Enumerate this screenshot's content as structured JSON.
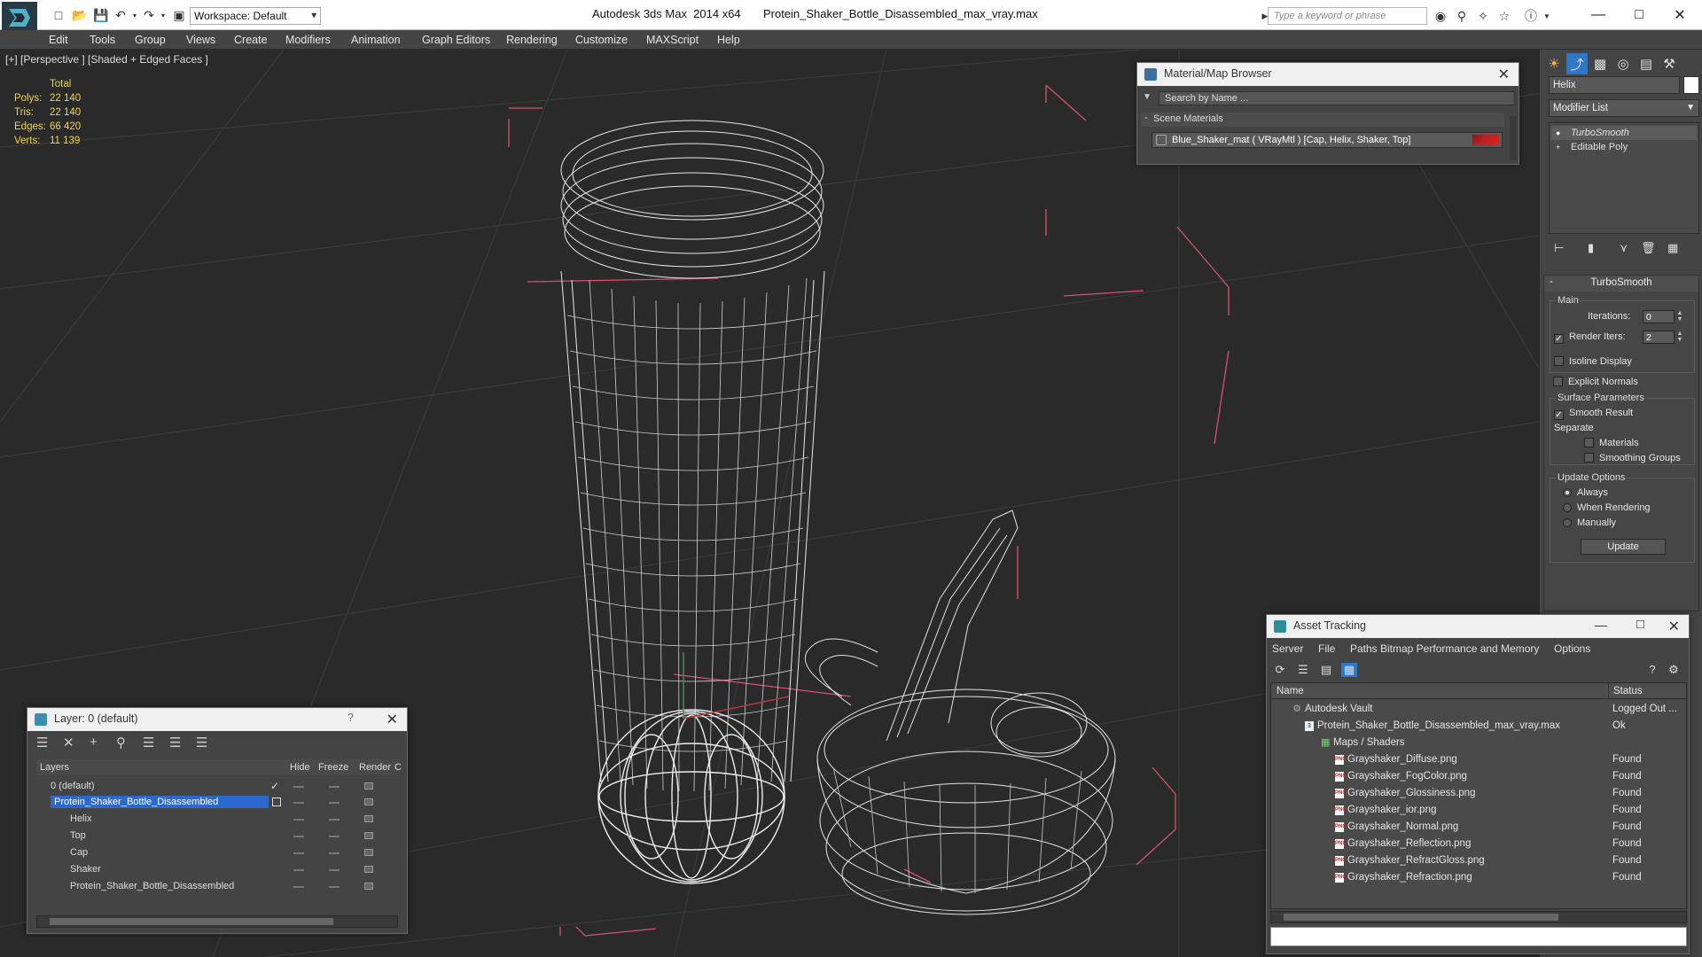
{
  "titlebar": {
    "workspace_label": "Workspace: Default",
    "app_title": "Autodesk 3ds Max  2014 x64",
    "file_title": "Protein_Shaker_Bottle_Disassembled_max_vray.max",
    "search_placeholder": "Type a keyword or phrase"
  },
  "menu": [
    "Edit",
    "Tools",
    "Group",
    "Views",
    "Create",
    "Modifiers",
    "Animation",
    "Graph Editors",
    "Rendering",
    "Customize",
    "MAXScript",
    "Help"
  ],
  "viewport": {
    "label": "[+] [Perspective ] [Shaded + Edged Faces ]",
    "stats": {
      "header": "Total",
      "rows": [
        {
          "key": "Polys:",
          "value": "22 140"
        },
        {
          "key": "Tris:",
          "value": "22 140"
        },
        {
          "key": "Edges:",
          "value": "66 420"
        },
        {
          "key": "Verts:",
          "value": "11 139"
        }
      ]
    }
  },
  "command_panel": {
    "object_name": "Helix",
    "modifier_list": "Modifier List",
    "stack": [
      "TurboSmooth",
      "Editable Poly"
    ],
    "rollout_title": "TurboSmooth",
    "main_group": "Main",
    "iterations_label": "Iterations:",
    "iterations_value": "0",
    "render_iters_label": "Render Iters:",
    "render_iters_value": "2",
    "isoline_label": "Isoline Display",
    "explicit_normals_label": "Explicit Normals",
    "surface_group": "Surface Parameters",
    "smooth_result_label": "Smooth Result",
    "separate_label": "Separate",
    "materials_label": "Materials",
    "smoothing_groups_label": "Smoothing Groups",
    "update_group": "Update Options",
    "always_label": "Always",
    "when_rendering_label": "When Rendering",
    "manually_label": "Manually",
    "update_button": "Update"
  },
  "material_browser": {
    "title": "Material/Map Browser",
    "search_placeholder": "Search by Name ...",
    "section": "Scene Materials",
    "material": "Blue_Shaker_mat  ( VRayMtl ) [Cap, Helix, Shaker, Top]"
  },
  "layer_window": {
    "title": "Layer: 0 (default)",
    "help": "?",
    "columns": {
      "layers": "Layers",
      "hide": "Hide",
      "freeze": "Freeze",
      "render": "Render",
      "c": "C"
    },
    "rows": [
      {
        "name": "0 (default)"
      },
      {
        "name": "Protein_Shaker_Bottle_Disassembled"
      },
      {
        "name": "Helix"
      },
      {
        "name": "Top"
      },
      {
        "name": "Cap"
      },
      {
        "name": "Shaker"
      },
      {
        "name": "Protein_Shaker_Bottle_Disassembled"
      }
    ]
  },
  "asset_tracking": {
    "title": "Asset Tracking",
    "menu": [
      "Server",
      "File",
      "Paths",
      "Bitmap Performance and Memory",
      "Options"
    ],
    "col_name": "Name",
    "col_status": "Status",
    "rows": [
      {
        "name": "Autodesk Vault",
        "status": "Logged Out ..."
      },
      {
        "name": "Protein_Shaker_Bottle_Disassembled_max_vray.max",
        "status": "Ok"
      },
      {
        "name": "Maps / Shaders",
        "status": ""
      },
      {
        "name": "Grayshaker_Diffuse.png",
        "status": "Found"
      },
      {
        "name": "Grayshaker_FogColor.png",
        "status": "Found"
      },
      {
        "name": "Grayshaker_Glossiness.png",
        "status": "Found"
      },
      {
        "name": "Grayshaker_ior.png",
        "status": "Found"
      },
      {
        "name": "Grayshaker_Normal.png",
        "status": "Found"
      },
      {
        "name": "Grayshaker_Reflection.png",
        "status": "Found"
      },
      {
        "name": "Grayshaker_RefractGloss.png",
        "status": "Found"
      },
      {
        "name": "Grayshaker_Refraction.png",
        "status": "Found"
      }
    ]
  }
}
